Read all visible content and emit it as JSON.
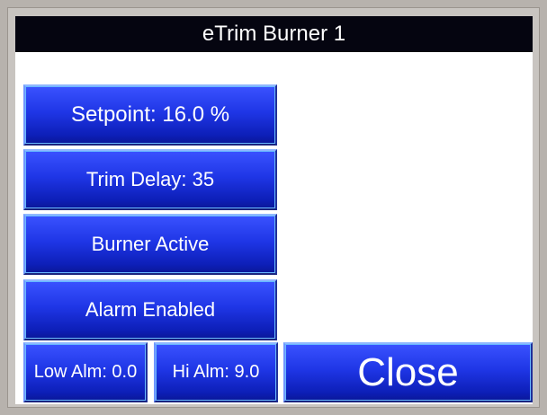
{
  "window": {
    "title": "eTrim Burner 1"
  },
  "buttons": {
    "setpoint": "Setpoint: 16.0 %",
    "trim_delay": "Trim Delay: 35",
    "burner_active": "Burner Active",
    "alarm_enabled": "Alarm Enabled",
    "low_alarm": "Low Alm: 0.0",
    "hi_alarm": "Hi Alm: 9.0",
    "close": "Close"
  },
  "colors": {
    "title_bar_bg": "#050510",
    "button_gradient_top": "#3a52ff",
    "button_gradient_bottom": "#0a1798",
    "screen_bg": "#ffffff",
    "bezel": "#c8c4c0"
  }
}
